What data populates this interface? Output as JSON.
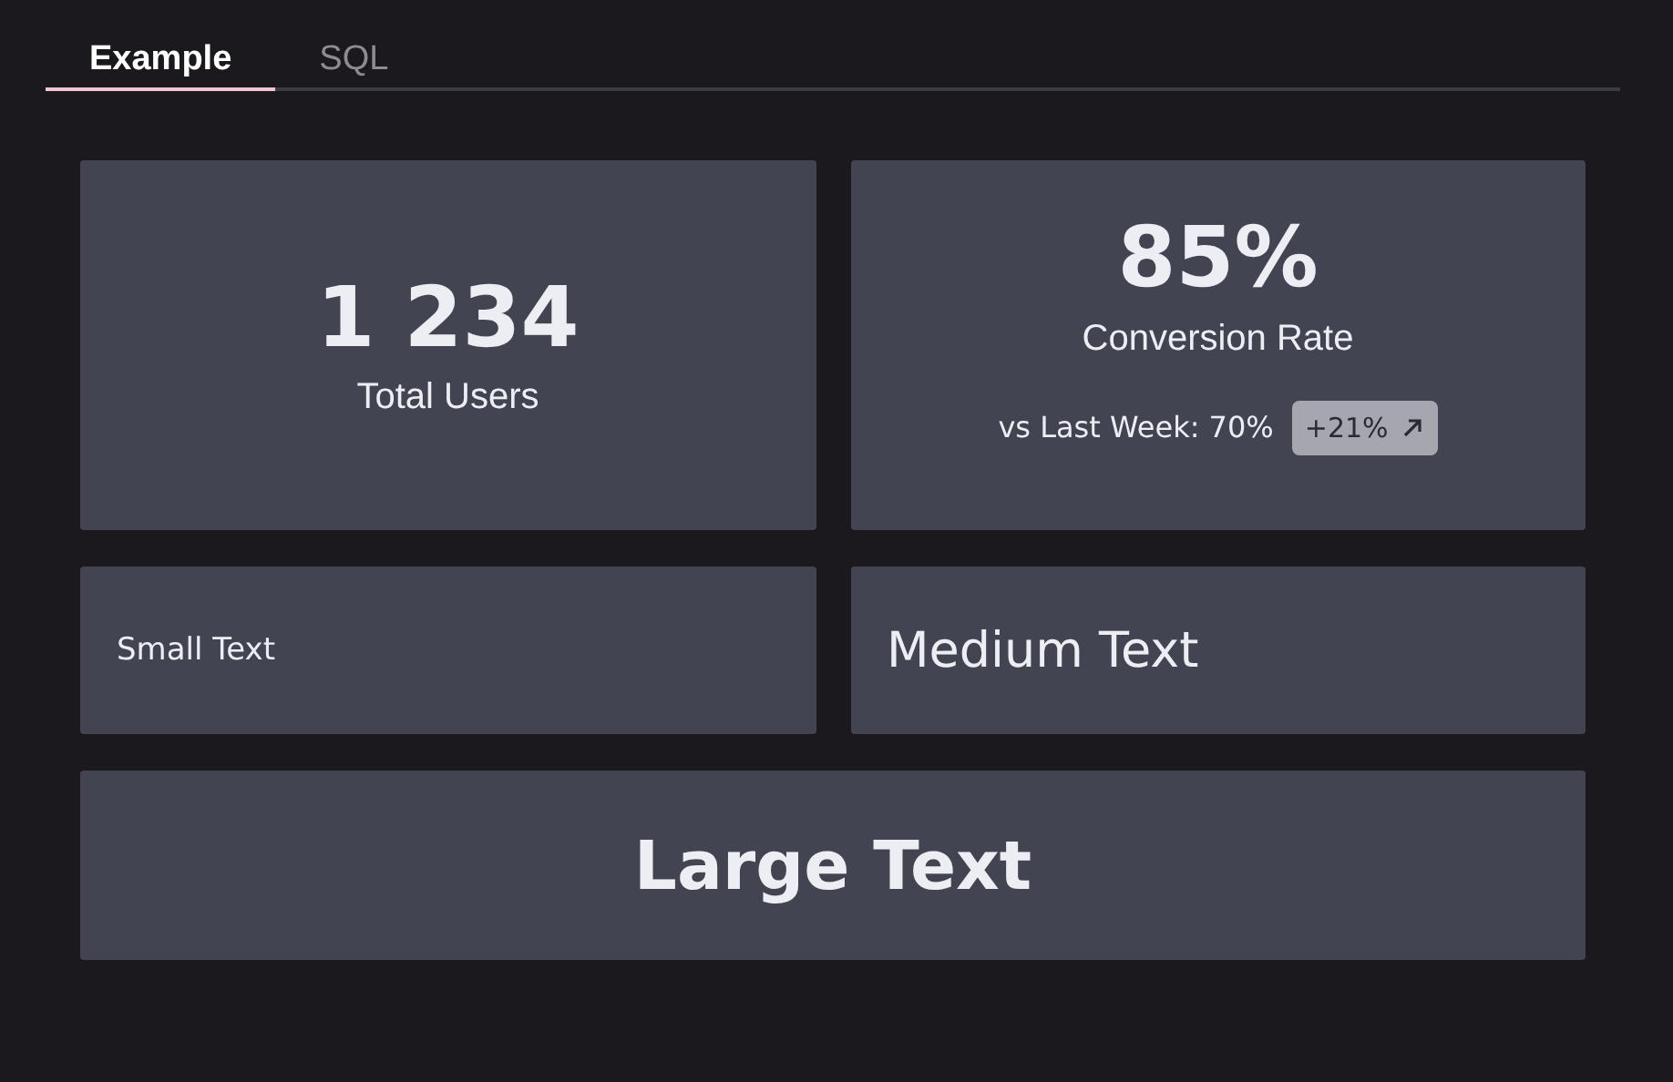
{
  "tabs": [
    {
      "label": "Example",
      "selected": true
    },
    {
      "label": "SQL",
      "selected": false
    }
  ],
  "cards": [
    {
      "kind": "metric",
      "value": "1 234",
      "label": "Total Users"
    },
    {
      "kind": "metric",
      "value": "85%",
      "label": "Conversion Rate",
      "comparison": {
        "text": "vs Last Week: 70%",
        "delta": "+21%",
        "rising": true
      }
    },
    {
      "kind": "small",
      "text": "Small Text"
    },
    {
      "kind": "medium",
      "text": "Medium Text"
    },
    {
      "kind": "large",
      "text": "Large Text"
    }
  ]
}
